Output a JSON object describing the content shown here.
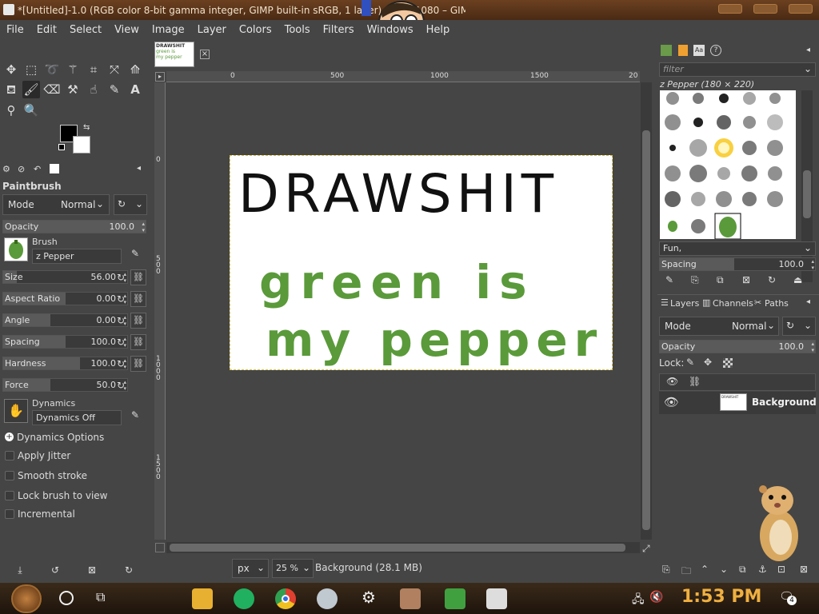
{
  "window": {
    "title": "*[Untitled]-1.0 (RGB color 8-bit gamma integer, GIMP built-in sRGB, 1 layer) 1920x1080 – GIMP"
  },
  "menu": [
    "File",
    "Edit",
    "Select",
    "View",
    "Image",
    "Layer",
    "Colors",
    "Tools",
    "Filters",
    "Windows",
    "Help"
  ],
  "tool_options": {
    "title": "Paintbrush",
    "mode_label": "Mode",
    "mode_value": "Normal",
    "opacity_label": "Opacity",
    "opacity_value": "100.0",
    "brush_label": "Brush",
    "brush_value": "z Pepper",
    "sliders": [
      {
        "label": "Size",
        "value": "56.00",
        "fraction": 0.11
      },
      {
        "label": "Aspect Ratio",
        "value": "0.00",
        "fraction": 0.5
      },
      {
        "label": "Angle",
        "value": "0.00",
        "fraction": 0.5
      },
      {
        "label": "Spacing",
        "value": "100.0",
        "fraction": 0.5
      },
      {
        "label": "Hardness",
        "value": "100.0",
        "fraction": 1.0
      },
      {
        "label": "Force",
        "value": "50.0",
        "fraction": 0.5
      }
    ],
    "dynamics_label": "Dynamics",
    "dynamics_value": "Dynamics Off",
    "dynamics_options": "Dynamics Options",
    "checks": [
      "Apply Jitter",
      "Smooth stroke",
      "Lock brush to view",
      "Incremental"
    ]
  },
  "ruler": {
    "h_ticks": [
      "0",
      "500",
      "1000",
      "1500",
      "20"
    ],
    "v_ticks": [
      "0",
      "5\n0\n0",
      "1\n0\n0\n0",
      "1\n5\n0\n0"
    ]
  },
  "canvas": {
    "text_line1": "DRAWSHIT",
    "text_line2": "green is",
    "text_line3": "my pepper"
  },
  "status": {
    "unit": "px",
    "zoom": "25 %",
    "info": "Background (28.1 MB)"
  },
  "brushes": {
    "filter_placeholder": "filter",
    "current": "z Pepper (180 × 220)",
    "tag": "Fun,",
    "spacing_label": "Spacing",
    "spacing_value": "100.0"
  },
  "layers": {
    "tabs": [
      "Layers",
      "Channels",
      "Paths"
    ],
    "mode_label": "Mode",
    "mode_value": "Normal",
    "opacity_label": "Opacity",
    "opacity_value": "100.0",
    "lock_label": "Lock:",
    "layer_name": "Background"
  },
  "taskbar": {
    "time": "1:53 PM",
    "notif_count": "4"
  },
  "colors": {
    "accent": "#f0b040",
    "foreground": "#000000",
    "background": "#ffffff",
    "pepper": "#5a9a3a"
  }
}
